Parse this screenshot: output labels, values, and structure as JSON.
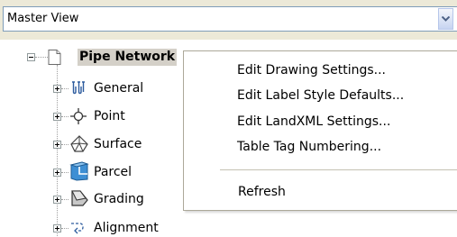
{
  "view_selector": {
    "value": "Master View"
  },
  "tree": {
    "root": {
      "label": "Pipe Network",
      "icon": "document-icon"
    },
    "children": [
      {
        "label": "General",
        "icon": "general-styles-icon"
      },
      {
        "label": "Point",
        "icon": "point-icon"
      },
      {
        "label": "Surface",
        "icon": "surface-icon"
      },
      {
        "label": "Parcel",
        "icon": "parcel-icon"
      },
      {
        "label": "Grading",
        "icon": "grading-icon"
      },
      {
        "label": "Alignment",
        "icon": "alignment-icon"
      }
    ]
  },
  "context_menu": {
    "items": [
      {
        "label": "Edit Drawing Settings..."
      },
      {
        "label": "Edit Label Style Defaults..."
      },
      {
        "label": "Edit LandXML Settings..."
      },
      {
        "label": "Table Tag Numbering..."
      },
      {
        "label": "Refresh"
      }
    ]
  }
}
